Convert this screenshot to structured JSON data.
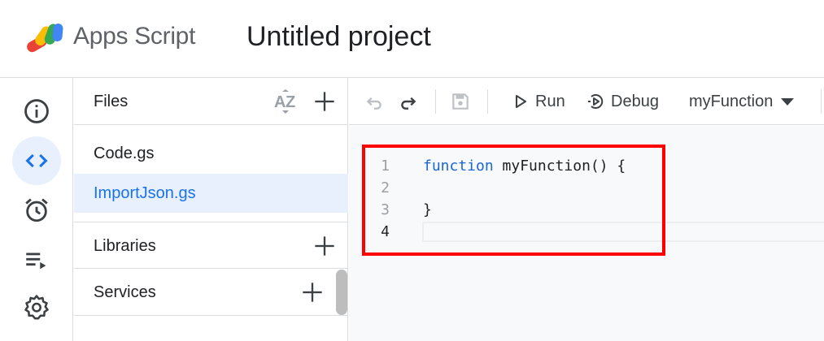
{
  "header": {
    "brand": "Apps Script",
    "project_title": "Untitled project"
  },
  "rail": {
    "items": [
      {
        "name": "overview",
        "icon": "info-icon",
        "active": false
      },
      {
        "name": "editor",
        "icon": "code-icon",
        "active": true
      },
      {
        "name": "triggers",
        "icon": "alarm-icon",
        "active": false
      },
      {
        "name": "executions",
        "icon": "playlist-icon",
        "active": false
      },
      {
        "name": "settings",
        "icon": "gear-icon",
        "active": false
      }
    ]
  },
  "files_panel": {
    "files_label": "Files",
    "sort_icon": "sort-az-icon",
    "files": [
      {
        "label": "Code.gs",
        "selected": false
      },
      {
        "label": "ImportJson.gs",
        "selected": true
      }
    ],
    "libraries_label": "Libraries",
    "services_label": "Services"
  },
  "toolbar": {
    "run_label": "Run",
    "debug_label": "Debug",
    "function_select": "myFunction"
  },
  "editor": {
    "lines": [
      {
        "num": "1",
        "keyword": "function",
        "rest": " myFunction() {"
      },
      {
        "num": "2",
        "keyword": "",
        "rest": ""
      },
      {
        "num": "3",
        "keyword": "",
        "rest": "}"
      },
      {
        "num": "4",
        "keyword": "",
        "rest": ""
      }
    ],
    "current_line": "4"
  },
  "colors": {
    "accent": "#1a73e8",
    "selected_bg": "#e8f0fe",
    "highlight_box": "#ff0000",
    "keyword": "#1967d2"
  }
}
